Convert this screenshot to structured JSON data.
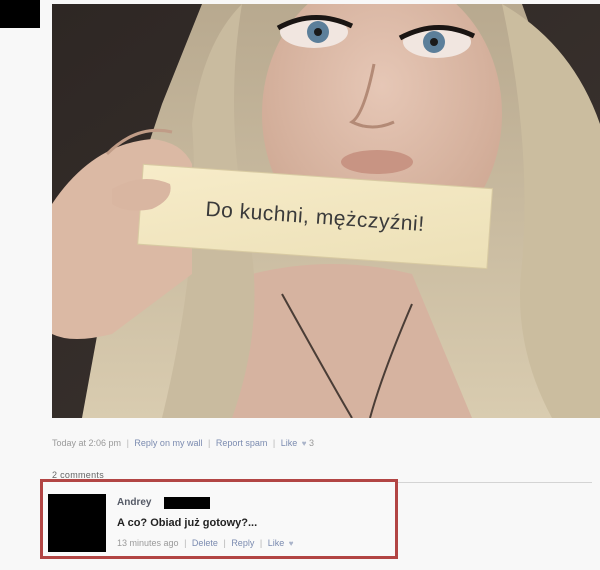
{
  "post": {
    "image_note_text": "Do kuchni, mężczyźni!",
    "meta": {
      "timestamp": "Today at 2:06 pm",
      "reply_link": "Reply on my wall",
      "report_link": "Report spam",
      "like_link": "Like",
      "like_icon": "heart-icon",
      "like_count": "3"
    },
    "comments_count": "2 comments"
  },
  "comment": {
    "author": "Andrey",
    "text": "A co? Obiad już gotowy?...",
    "meta": {
      "time": "13 minutes ago",
      "delete_link": "Delete",
      "reply_link": "Reply",
      "like_link": "Like",
      "like_icon": "heart-icon"
    },
    "highlight_color": "#b24544"
  }
}
